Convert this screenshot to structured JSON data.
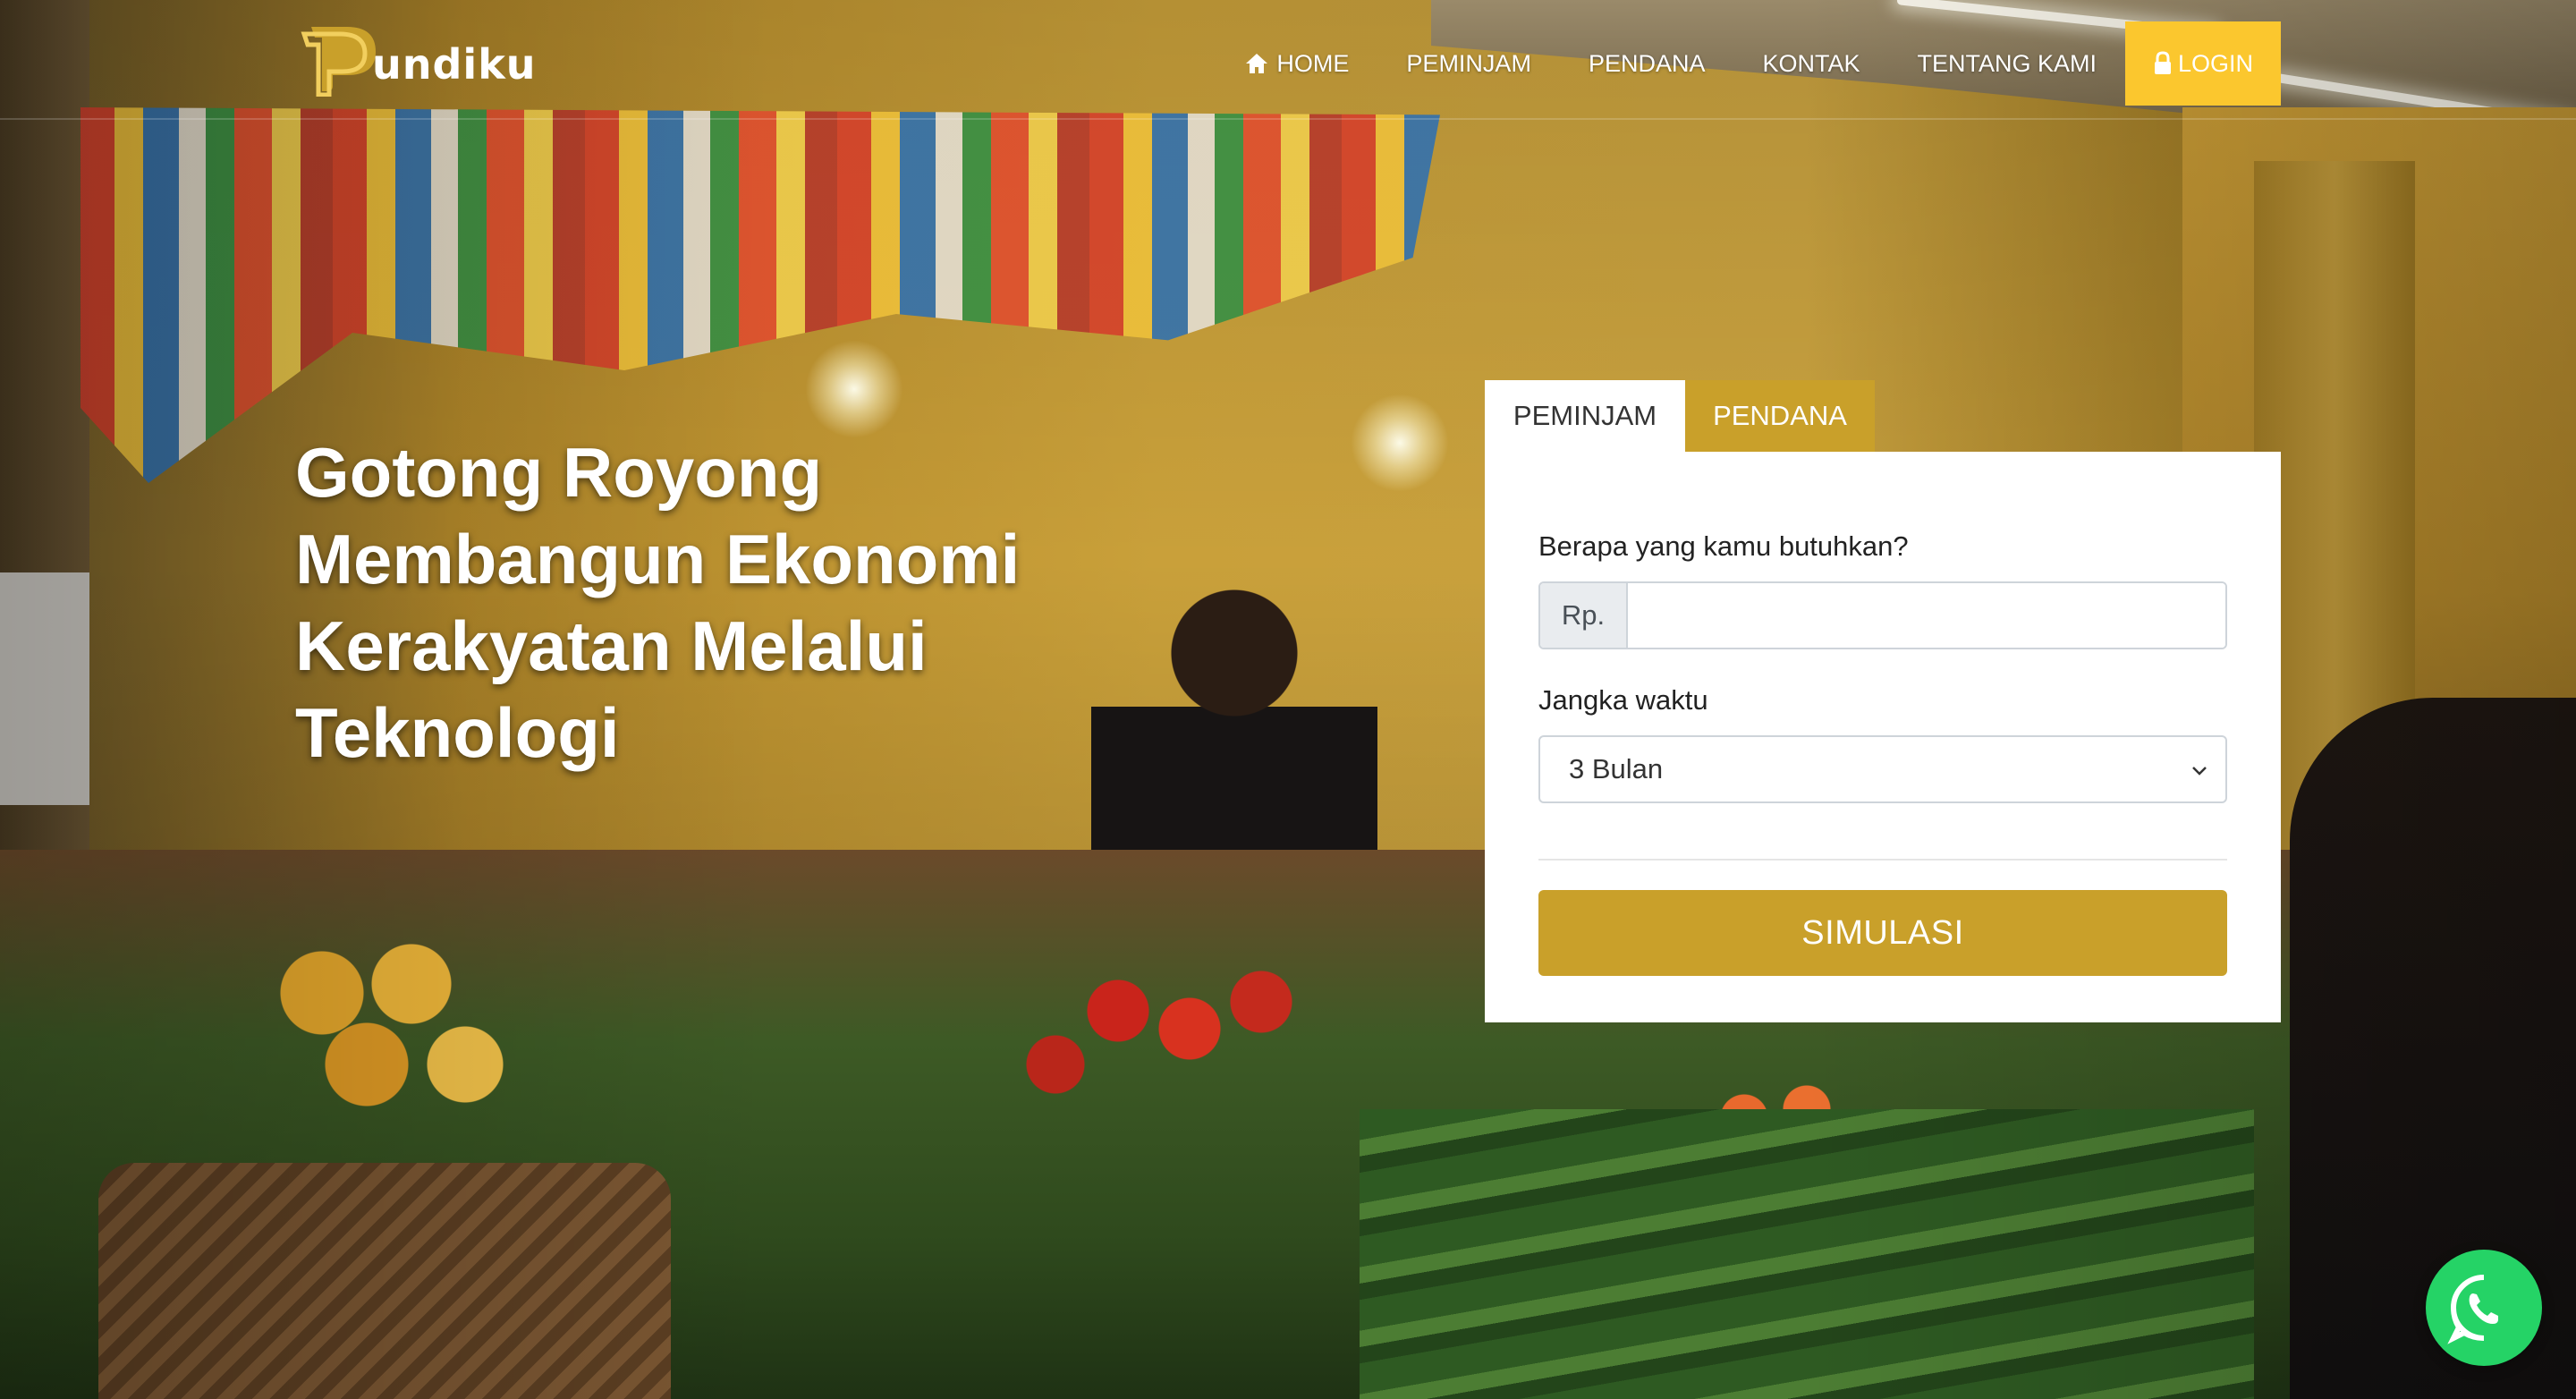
{
  "brand": {
    "logo_text": "undiku",
    "accent_color": "#c9a02a",
    "login_color": "#fbc72e",
    "whatsapp_color": "#25d366"
  },
  "nav": {
    "items": [
      {
        "label": "HOME",
        "icon": "home-icon"
      },
      {
        "label": "PEMINJAM"
      },
      {
        "label": "PENDANA"
      },
      {
        "label": "KONTAK"
      },
      {
        "label": "TENTANG KAMI"
      }
    ],
    "login": {
      "label": "LOGIN",
      "icon": "lock-icon"
    }
  },
  "hero": {
    "headline_lines": [
      "Gotong Royong",
      "Membangun Ekonomi",
      "Kerakyatan Melalui",
      "Teknologi"
    ]
  },
  "simulator": {
    "tabs": [
      {
        "label": "PEMINJAM",
        "active": true
      },
      {
        "label": "PENDANA",
        "active": false
      }
    ],
    "amount_label": "Berapa yang kamu butuhkan?",
    "amount_prefix": "Rp.",
    "amount_value": "",
    "amount_placeholder": "",
    "term_label": "Jangka waktu",
    "term_selected": "3 Bulan",
    "submit_label": "SIMULASI"
  },
  "floating": {
    "whatsapp_icon": "whatsapp-icon"
  }
}
